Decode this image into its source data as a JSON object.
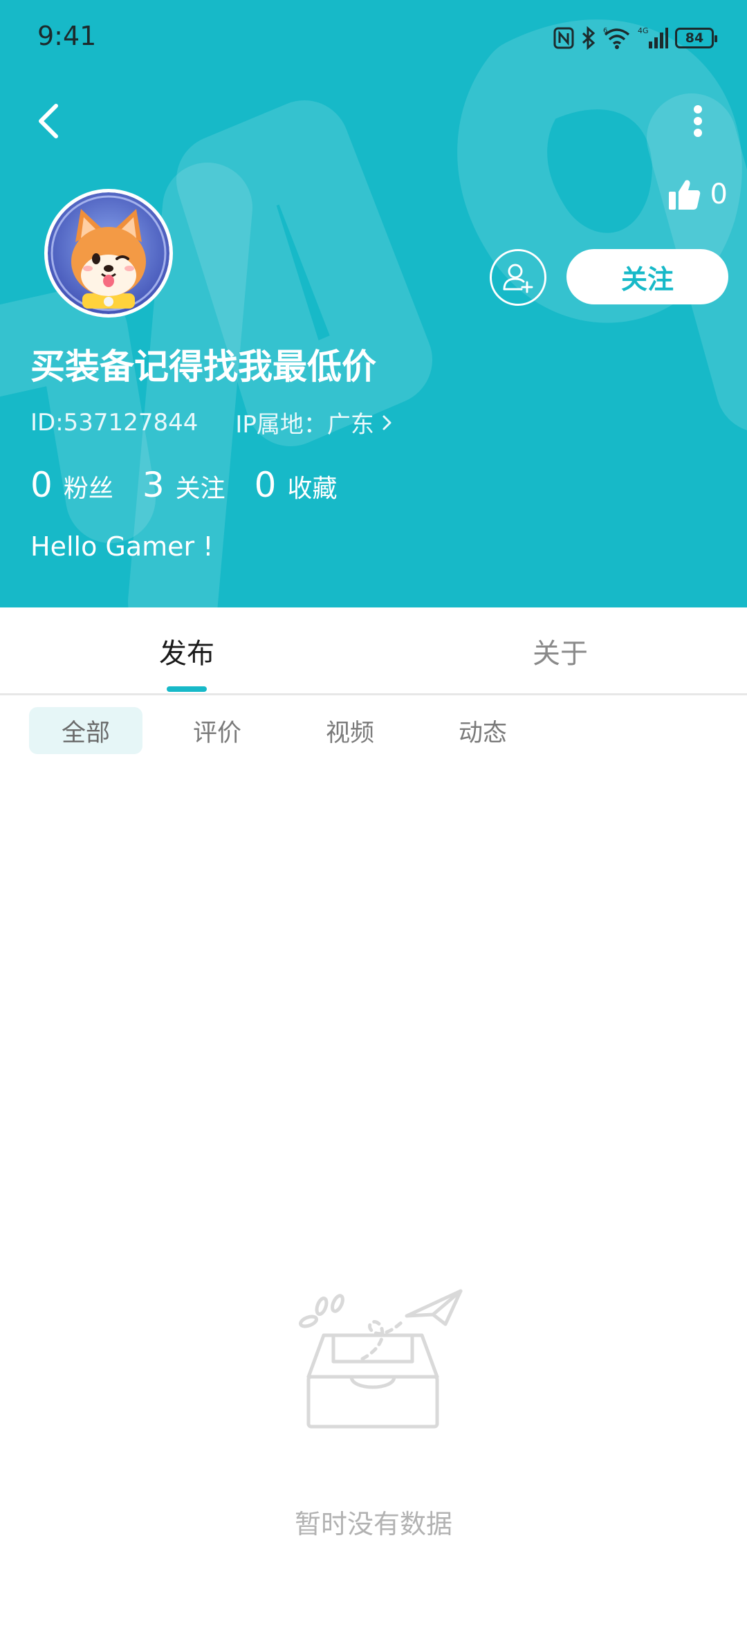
{
  "status": {
    "time": "9:41",
    "battery": "84",
    "network": "4G"
  },
  "header": {
    "like_count": "0",
    "follow_label": "关注",
    "username": "买装备记得找我最低价",
    "user_id": "ID:537127844",
    "ip_location": "IP属地：广东",
    "stats": [
      {
        "num": "0",
        "label": "粉丝"
      },
      {
        "num": "3",
        "label": "关注"
      },
      {
        "num": "0",
        "label": "收藏"
      }
    ],
    "bio": "Hello Gamer !",
    "background_color": "#17b9c8"
  },
  "tabs": [
    {
      "label": "发布",
      "active": true
    },
    {
      "label": "关于",
      "active": false
    }
  ],
  "subtabs": [
    {
      "label": "全部",
      "active": true
    },
    {
      "label": "评价",
      "active": false
    },
    {
      "label": "视频",
      "active": false
    },
    {
      "label": "动态",
      "active": false
    }
  ],
  "empty_state": {
    "text": "暂时没有数据"
  },
  "icons": [
    "back-icon",
    "more-icon",
    "thumbs-up-icon",
    "add-friend-icon",
    "chevron-right-icon",
    "empty-box-icon",
    "nfc-icon",
    "bluetooth-icon",
    "wifi-icon",
    "signal-icon",
    "battery-icon"
  ]
}
